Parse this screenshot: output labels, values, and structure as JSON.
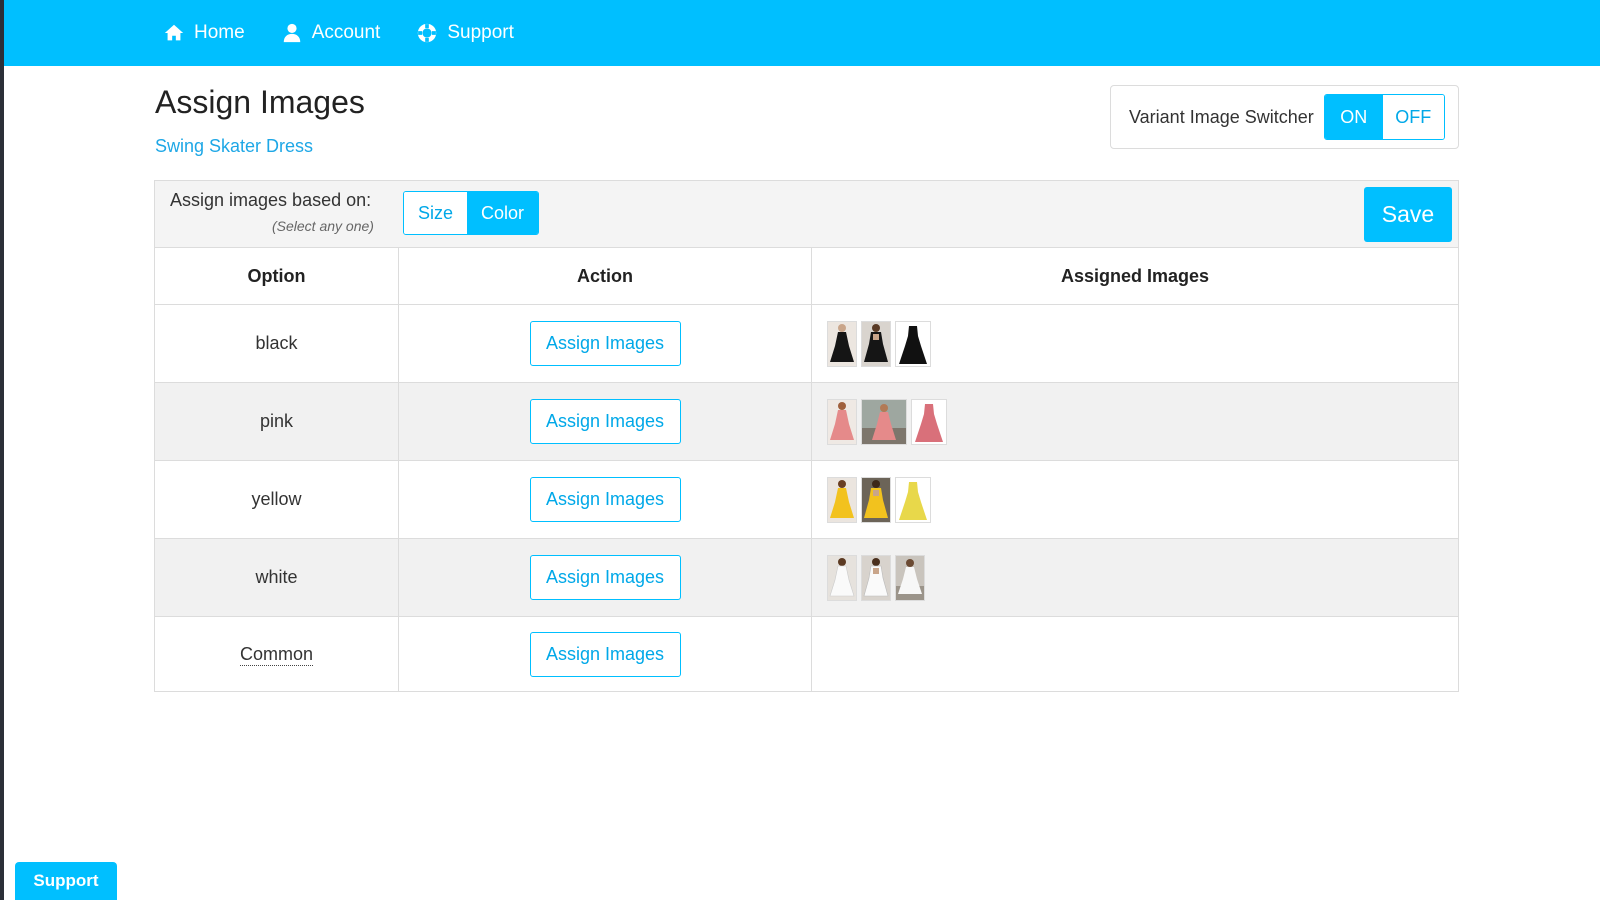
{
  "nav": {
    "items": [
      {
        "label": "Home",
        "icon": "home-icon"
      },
      {
        "label": "Account",
        "icon": "user-icon"
      },
      {
        "label": "Support",
        "icon": "lifebuoy-icon"
      }
    ]
  },
  "header": {
    "title": "Assign Images",
    "product_name": "Swing Skater Dress"
  },
  "switcher": {
    "label": "Variant Image Switcher",
    "on_label": "ON",
    "off_label": "OFF",
    "state": "ON"
  },
  "assign_by": {
    "label": "Assign images based on:",
    "hint": "(Select any one)",
    "options": [
      "Size",
      "Color"
    ],
    "selected": "Color"
  },
  "save_label": "Save",
  "table": {
    "headers": [
      "Option",
      "Action",
      "Assigned Images"
    ],
    "rows": [
      {
        "option": "black",
        "action": "Assign Images",
        "images": [
          "black dress front",
          "black dress back",
          "black dress flat"
        ]
      },
      {
        "option": "pink",
        "action": "Assign Images",
        "images": [
          "pink dress front",
          "pink dress outdoor",
          "pink dress flat"
        ]
      },
      {
        "option": "yellow",
        "action": "Assign Images",
        "images": [
          "yellow dress front",
          "yellow dress back",
          "yellow dress flat"
        ]
      },
      {
        "option": "white",
        "action": "Assign Images",
        "images": [
          "white dress front",
          "white dress back",
          "white dress room"
        ]
      },
      {
        "option": "Common",
        "action": "Assign Images",
        "images": []
      }
    ]
  },
  "support_tab": "Support",
  "colors": {
    "brand": "#00bfff",
    "black_dress": "#151515",
    "pink_dress": "#e58a8a",
    "yellow_dress": "#f2cf2a",
    "white_dress": "#f7f7f7"
  }
}
